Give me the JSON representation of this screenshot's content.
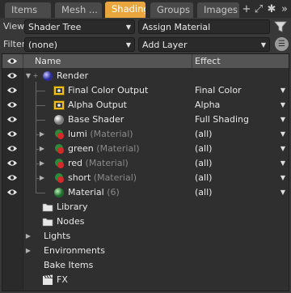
{
  "tabs": [
    {
      "label": "Items",
      "active": false
    },
    {
      "label": "Mesh ...",
      "active": false
    },
    {
      "label": "Shading",
      "active": true
    },
    {
      "label": "Groups",
      "active": false
    },
    {
      "label": "Images",
      "active": false
    }
  ],
  "tab_icons": {
    "add": "+",
    "popout": "⤢",
    "settings": "✱",
    "more": "»"
  },
  "view": {
    "label": "View",
    "value": "Shader Tree",
    "action": "Assign Material"
  },
  "filter": {
    "label": "Filter",
    "value": "(none)",
    "action": "Add Layer"
  },
  "columns": {
    "name": "Name",
    "effect": "Effect"
  },
  "tree": [
    {
      "name": "Render",
      "sub": "",
      "effect": "",
      "icon": "render-sphere-icon",
      "eye": true
    },
    {
      "name": "Final Color Output",
      "sub": "",
      "effect": "Final Color",
      "icon": "render-output-icon",
      "eye": true
    },
    {
      "name": "Alpha Output",
      "sub": "",
      "effect": "Alpha",
      "icon": "render-output-icon",
      "eye": true
    },
    {
      "name": "Base Shader",
      "sub": "",
      "effect": "Full Shading",
      "icon": "shader-ball-icon",
      "eye": true
    },
    {
      "name": "lumi",
      "sub": "(Material)",
      "effect": "(all)",
      "icon": "material-mask-icon",
      "eye": true
    },
    {
      "name": "green",
      "sub": "(Material)",
      "effect": "(all)",
      "icon": "material-mask-icon",
      "eye": true
    },
    {
      "name": "red",
      "sub": "(Material)",
      "effect": "(all)",
      "icon": "material-mask-icon",
      "eye": true
    },
    {
      "name": "short",
      "sub": "(Material)",
      "effect": "(all)",
      "icon": "material-mask-icon",
      "eye": true
    },
    {
      "name": "Material",
      "sub": "(6)",
      "effect": "(all)",
      "icon": "material-green-icon",
      "eye": true
    },
    {
      "name": "Library",
      "sub": "",
      "effect": "",
      "icon": "folder-icon",
      "eye": false
    },
    {
      "name": "Nodes",
      "sub": "",
      "effect": "",
      "icon": "folder-icon",
      "eye": false
    },
    {
      "name": "Lights",
      "sub": "",
      "effect": "",
      "icon": "",
      "eye": false
    },
    {
      "name": "Environments",
      "sub": "",
      "effect": "",
      "icon": "",
      "eye": false
    },
    {
      "name": "Bake Items",
      "sub": "",
      "effect": "",
      "icon": "",
      "eye": false
    },
    {
      "name": "FX",
      "sub": "",
      "effect": "",
      "icon": "clapper-icon",
      "eye": false
    }
  ],
  "colors": {
    "accent": "#e9a63f",
    "panel_bg": "#2f2f2f",
    "header_bg": "#545454"
  }
}
